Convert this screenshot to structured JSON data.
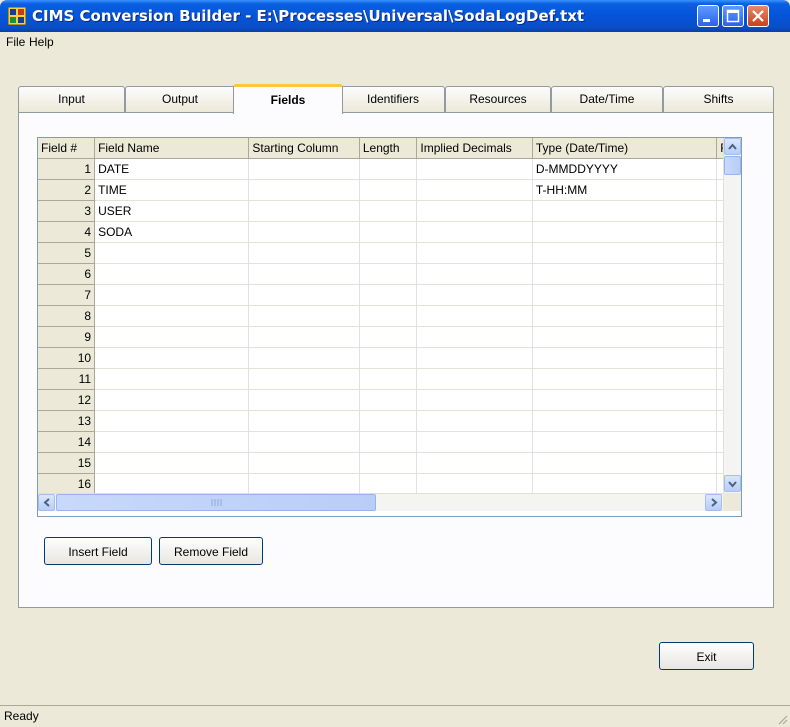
{
  "window": {
    "title": "CIMS Conversion Builder - E:\\Processes\\Universal\\SodaLogDef.txt"
  },
  "menu": {
    "items": [
      "File",
      "Help"
    ]
  },
  "tabs": [
    "Input",
    "Output",
    "Fields",
    "Identifiers",
    "Resources",
    "Date/Time",
    "Shifts"
  ],
  "active_tab": "Fields",
  "grid": {
    "columns": [
      "Field #",
      "Field Name",
      "Starting Column",
      "Length",
      "Implied Decimals",
      "Type (Date/Time)",
      "F"
    ],
    "rows": [
      {
        "num": "1",
        "name": "DATE",
        "start": "",
        "length": "",
        "decimals": "",
        "type": "D-MMDDYYYY"
      },
      {
        "num": "2",
        "name": "TIME",
        "start": "",
        "length": "",
        "decimals": "",
        "type": "T-HH:MM"
      },
      {
        "num": "3",
        "name": "USER",
        "start": "",
        "length": "",
        "decimals": "",
        "type": ""
      },
      {
        "num": "4",
        "name": "SODA",
        "start": "",
        "length": "",
        "decimals": "",
        "type": ""
      },
      {
        "num": "5",
        "name": "",
        "start": "",
        "length": "",
        "decimals": "",
        "type": ""
      },
      {
        "num": "6",
        "name": "",
        "start": "",
        "length": "",
        "decimals": "",
        "type": ""
      },
      {
        "num": "7",
        "name": "",
        "start": "",
        "length": "",
        "decimals": "",
        "type": ""
      },
      {
        "num": "8",
        "name": "",
        "start": "",
        "length": "",
        "decimals": "",
        "type": ""
      },
      {
        "num": "9",
        "name": "",
        "start": "",
        "length": "",
        "decimals": "",
        "type": ""
      },
      {
        "num": "10",
        "name": "",
        "start": "",
        "length": "",
        "decimals": "",
        "type": ""
      },
      {
        "num": "11",
        "name": "",
        "start": "",
        "length": "",
        "decimals": "",
        "type": ""
      },
      {
        "num": "12",
        "name": "",
        "start": "",
        "length": "",
        "decimals": "",
        "type": ""
      },
      {
        "num": "13",
        "name": "",
        "start": "",
        "length": "",
        "decimals": "",
        "type": ""
      },
      {
        "num": "14",
        "name": "",
        "start": "",
        "length": "",
        "decimals": "",
        "type": ""
      },
      {
        "num": "15",
        "name": "",
        "start": "",
        "length": "",
        "decimals": "",
        "type": ""
      },
      {
        "num": "16",
        "name": "",
        "start": "",
        "length": "",
        "decimals": "",
        "type": ""
      }
    ]
  },
  "buttons": {
    "insert_field": "Insert Field",
    "remove_field": "Remove Field",
    "exit": "Exit"
  },
  "status": {
    "text": "Ready"
  },
  "colors": {
    "titlebar": "#0454d8",
    "face": "#ece9d8",
    "active_tab_accent": "#ffc83c"
  }
}
